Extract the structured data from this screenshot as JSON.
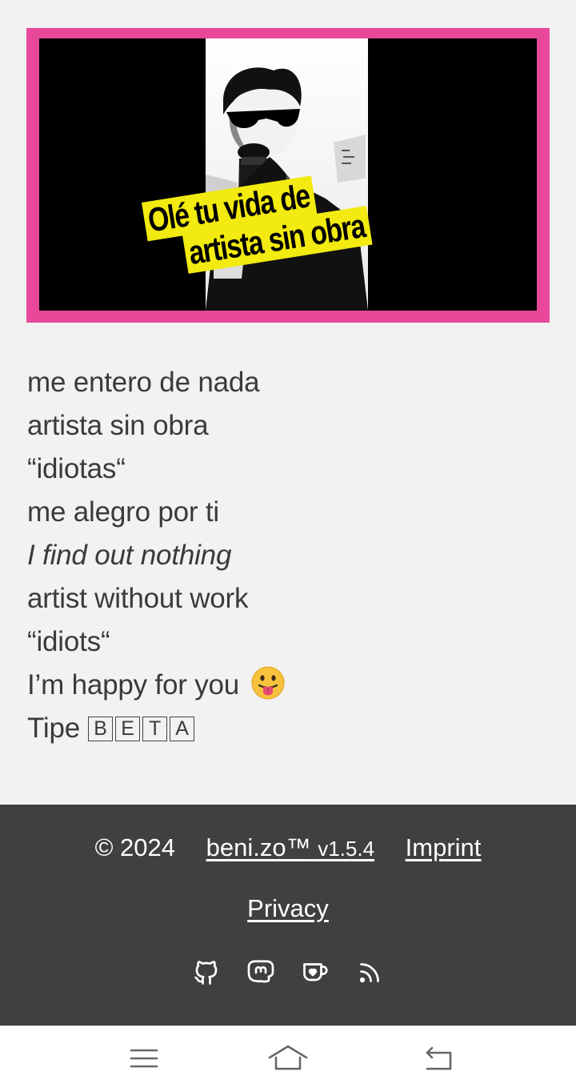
{
  "hero": {
    "caption_line1": "Olé tu vida de",
    "caption_line2": "artista sin obra",
    "colors": {
      "frame": "#e8489a",
      "caption_bg": "#f2ea10"
    }
  },
  "lyrics": {
    "lines": [
      "me entero de nada",
      "artista sin obra",
      "“idiotas“",
      "me alegro por ti",
      "I find out nothing",
      "artist without work",
      "“idiots“",
      "I’m happy for you",
      "Tipe"
    ],
    "emoji": "face-with-tongue-icon",
    "beta_letters": [
      "B",
      "E",
      "T",
      "A"
    ]
  },
  "footer": {
    "copyright": "© 2024",
    "brand": "beni.zo™",
    "version": "v1.5.4",
    "imprint": "Imprint",
    "privacy": "Privacy",
    "icons": [
      "github-icon",
      "mastodon-icon",
      "kofi-icon",
      "rss-icon"
    ],
    "bg_color": "#404040"
  },
  "navbar": {
    "buttons": [
      "menu-icon",
      "home-icon",
      "back-icon"
    ]
  }
}
